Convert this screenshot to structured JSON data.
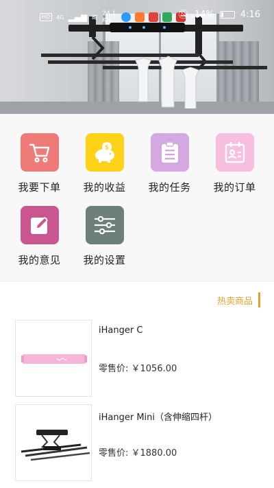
{
  "status_bar": {
    "left_text": "HD",
    "signal_label": "4G",
    "net_speed": "24.1 K/s",
    "battery": "14%",
    "time": "4:16"
  },
  "menu": {
    "items": [
      {
        "label": "我要下单",
        "icon": "cart-icon",
        "color": "#ef7b79"
      },
      {
        "label": "我的收益",
        "icon": "piggy-bank-icon",
        "color": "#ffd21a"
      },
      {
        "label": "我的任务",
        "icon": "clipboard-icon",
        "color": "#d4a8e0"
      },
      {
        "label": "我的订单",
        "icon": "calendar-contact-icon",
        "color": "#f7bedf"
      },
      {
        "label": "我的意见",
        "icon": "edit-icon",
        "color": "#c9568f"
      },
      {
        "label": "我的设置",
        "icon": "sliders-icon",
        "color": "#6d7f7b"
      }
    ]
  },
  "hot": {
    "title": "热卖商品"
  },
  "products": [
    {
      "name": "iHanger C",
      "price": "零售价: ￥1056.00"
    },
    {
      "name": "iHanger Mini（含伸缩四杆）",
      "price": "零售价: ￥1880.00"
    }
  ],
  "colors": {
    "accent": "#e6a12b"
  }
}
